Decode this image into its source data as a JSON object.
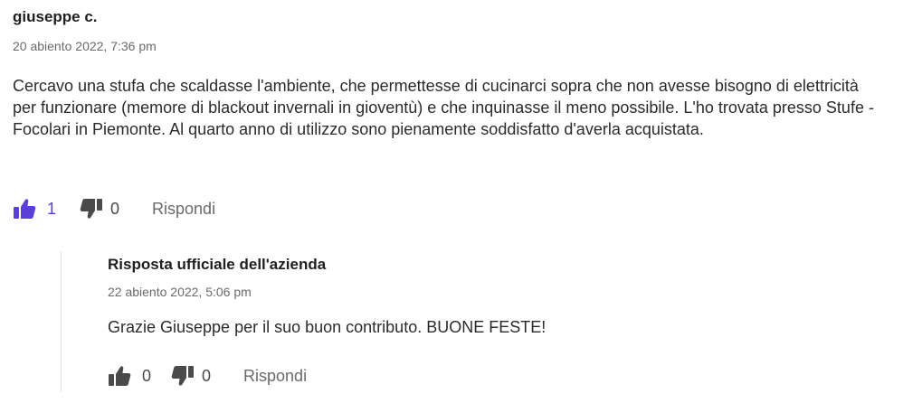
{
  "review": {
    "author": "giuseppe c.",
    "date": "20 abiento 2022, 7:36 pm",
    "text": "Cercavo una stufa che scaldasse l'ambiente, che permettesse di cucinarci sopra che non avesse bisogno di elettricità per funzionare (memore di blackout invernali in gioventù) e che inquinasse il meno possibile. L'ho trovata presso Stufe -Focolari in Piemonte. Al quarto anno di utilizzo sono pienamente soddisfatto d'averla acquistata.",
    "likes": "1",
    "dislikes": "0",
    "reply_label": "Rispondi"
  },
  "official_reply": {
    "author": "Risposta ufficiale dell'azienda",
    "date": "22 abiento 2022, 5:06 pm",
    "text": "Grazie Giuseppe per il suo buon contributo. BUONE FESTE!",
    "likes": "0",
    "dislikes": "0",
    "reply_label": "Rispondi"
  },
  "colors": {
    "accent": "#5a3fd8",
    "icon_muted": "#4a4a4a",
    "text": "#2b2b2b",
    "secondary": "#6a6a6a"
  },
  "icons": {
    "like_active": "thumbs-up-icon",
    "dislike": "thumbs-down-icon"
  }
}
